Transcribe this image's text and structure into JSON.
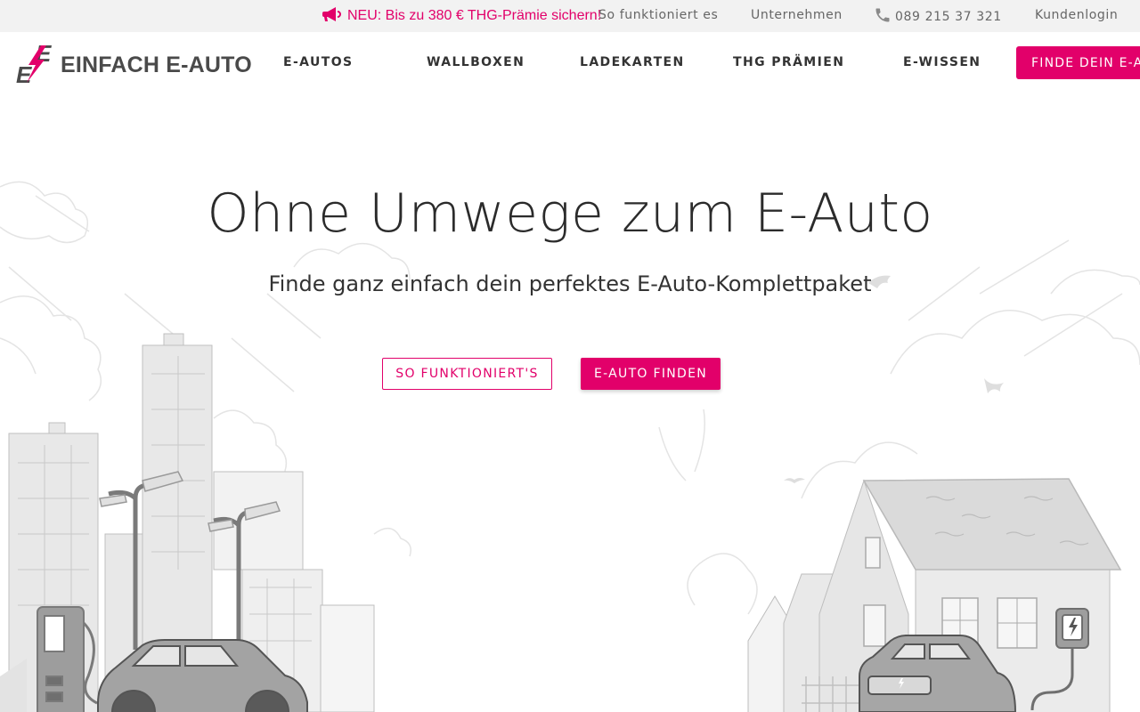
{
  "colors": {
    "accent": "#e2006a",
    "topbar_bg": "#f2f2f2",
    "text": "#2b2b2b",
    "illustration": "#d9d9d9"
  },
  "topbar": {
    "promo": {
      "icon": "megaphone-icon",
      "label": "NEU: Bis zu 380 € THG-Prämie sichern!"
    },
    "links": [
      "So funktioniert es",
      "Unternehmen"
    ],
    "phone": {
      "icon": "phone-icon",
      "number": "089 215 37 321"
    },
    "login_label": "Kundenlogin"
  },
  "nav": {
    "logo": {
      "icon": "lightning-e-logo",
      "text": "EINFACH E-AUTO"
    },
    "items": [
      "E-AUTOS",
      "WALLBOXEN",
      "LADEKARTEN",
      "THG PRÄMIEN",
      "E-WISSEN"
    ],
    "cta_label": "FINDE DEIN E-AUTO"
  },
  "hero": {
    "title": "Ohne Umwege zum E-Auto",
    "subtitle": "Finde ganz einfach dein perfektes E-Auto-Komplettpaket",
    "secondary_button": "SO FUNKTIONIERT'S",
    "primary_button": "E-AUTO FINDEN",
    "illustration": "city-and-house-ev-charging-illustration"
  }
}
